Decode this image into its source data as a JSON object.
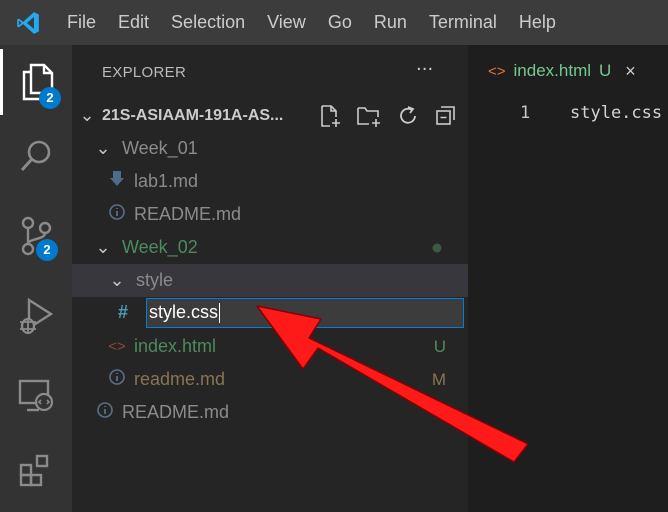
{
  "menu": [
    "File",
    "Edit",
    "Selection",
    "View",
    "Go",
    "Run",
    "Terminal",
    "Help"
  ],
  "activity": {
    "explorer_badge": "2",
    "scm_badge": "2"
  },
  "explorer": {
    "title": "EXPLORER",
    "more": "···",
    "project": "21S-ASIAAM-191A-AS...",
    "items": [
      {
        "label": "Week_01",
        "color": "#8b8b8b"
      },
      {
        "label": "lab1.md",
        "color": "#8b8b8b"
      },
      {
        "label": "README.md",
        "color": "#8b8b8b"
      },
      {
        "label": "Week_02",
        "color": "#73c991"
      },
      {
        "label": "style",
        "color": "#8b8b8b"
      },
      {
        "label": "index.html",
        "color": "#73c991",
        "decoration": "U"
      },
      {
        "label": "readme.md",
        "color": "#c4a065",
        "decoration": "M"
      },
      {
        "label": "README.md",
        "color": "#8b8b8b"
      }
    ],
    "rename_value": "style.css",
    "rename_icon": "#"
  },
  "tab": {
    "label": "index.html",
    "status": "U"
  },
  "editor": {
    "line_number": "1",
    "code": "style.css"
  },
  "colors": {
    "accent": "#007acc",
    "untracked": "#73c991",
    "modified": "#e2c08d",
    "arrow": "#ff0000"
  }
}
